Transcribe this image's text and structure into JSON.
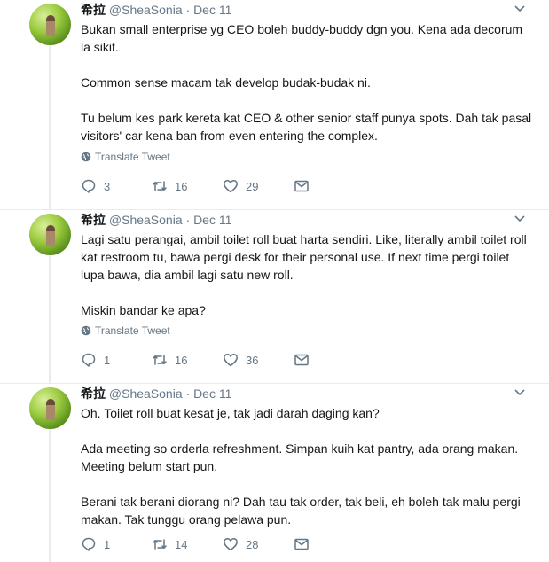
{
  "tweets": [
    {
      "name": "希拉",
      "handle": "@SheaSonia",
      "separator": "·",
      "date": "Dec 11",
      "paragraphs": [
        "Bukan small enterprise yg CEO boleh buddy-buddy dgn you. Kena ada decorum la sikit.",
        "Common sense macam tak develop budak-budak ni.",
        "Tu belum kes park kereta kat CEO & other senior staff punya spots. Dah tak pasal visitors' car kena ban from even entering the complex."
      ],
      "translate_label": "Translate Tweet",
      "replies": "3",
      "retweets": "16",
      "likes": "29"
    },
    {
      "name": "希拉",
      "handle": "@SheaSonia",
      "separator": "·",
      "date": "Dec 11",
      "paragraphs": [
        "Lagi satu perangai, ambil toilet roll buat harta sendiri. Like, literally ambil toilet roll kat restroom tu, bawa pergi desk for their personal use. If next time pergi toilet lupa bawa, dia ambil lagi satu new roll.",
        "Miskin bandar ke apa?"
      ],
      "translate_label": "Translate Tweet",
      "replies": "1",
      "retweets": "16",
      "likes": "36"
    },
    {
      "name": "希拉",
      "handle": "@SheaSonia",
      "separator": "·",
      "date": "Dec 11",
      "paragraphs": [
        "Oh. Toilet roll buat kesat je, tak jadi darah daging kan?",
        "Ada meeting so orderla refreshment. Simpan kuih kat pantry, ada orang makan. Meeting belum start pun.",
        "Berani tak berani diorang ni? Dah tau tak order, tak beli, eh boleh tak malu pergi makan. Tak tunggu orang pelawa pun."
      ],
      "translate_label": "",
      "replies": "1",
      "retweets": "14",
      "likes": "28"
    }
  ],
  "icons": {
    "reply": "reply-icon",
    "retweet": "retweet-icon",
    "like": "heart-icon",
    "dm": "envelope-icon",
    "caret": "chevron-down-icon",
    "globe": "globe-icon"
  },
  "colors": {
    "text": "#14171a",
    "secondary": "#657786",
    "thread_line": "#e6ecf0"
  }
}
